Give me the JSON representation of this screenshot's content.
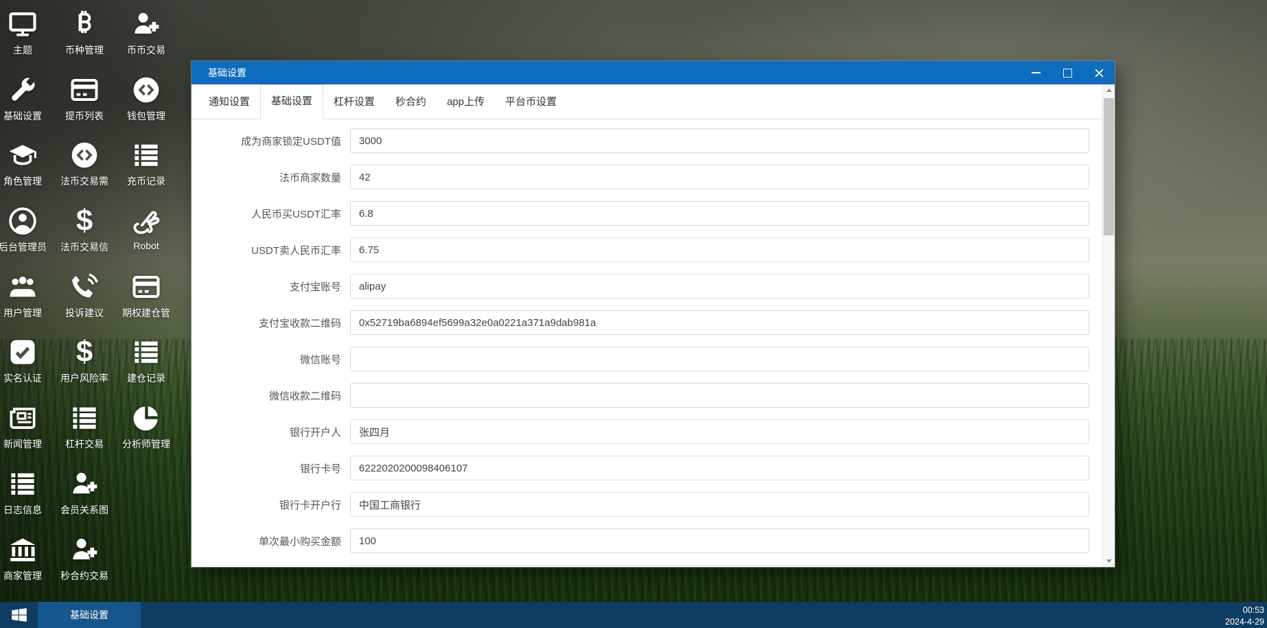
{
  "colors": {
    "titlebar_blue": "#0e6cbd",
    "taskbar_blue": "#0e3c63",
    "task_button_blue": "#17568a",
    "input_border": "#d9d9d9"
  },
  "sidebar": {
    "items": [
      {
        "label": "主题",
        "icon": "display-icon"
      },
      {
        "label": "币种管理",
        "icon": "bitcoin-icon"
      },
      {
        "label": "币币交易",
        "icon": "user-plus-icon"
      },
      {
        "label": "基础设置",
        "icon": "wrench-icon"
      },
      {
        "label": "提币列表",
        "icon": "credit-card-icon"
      },
      {
        "label": "钱包管理",
        "icon": "code-circle-icon"
      },
      {
        "label": "角色管理",
        "icon": "graduation-cap-icon"
      },
      {
        "label": "法币交易需",
        "icon": "code-circle-icon"
      },
      {
        "label": "充币记录",
        "icon": "list-icon"
      },
      {
        "label": "后台管理员",
        "icon": "user-circle-icon"
      },
      {
        "label": "法币交易信",
        "icon": "dollar-icon"
      },
      {
        "label": "Robot",
        "icon": "hand-icon"
      },
      {
        "label": "用户管理",
        "icon": "users-icon"
      },
      {
        "label": "投诉建议",
        "icon": "phone-volume-icon"
      },
      {
        "label": "期权建仓管",
        "icon": "credit-card-icon"
      },
      {
        "label": "实名认证",
        "icon": "check-square-icon"
      },
      {
        "label": "用户风险率",
        "icon": "dollar-icon"
      },
      {
        "label": "建仓记录",
        "icon": "list-icon"
      },
      {
        "label": "新闻管理",
        "icon": "newspaper-icon"
      },
      {
        "label": "杠杆交易",
        "icon": "list-icon"
      },
      {
        "label": "分析师管理",
        "icon": "pie-chart-icon"
      },
      {
        "label": "日志信息",
        "icon": "list-icon"
      },
      {
        "label": "会员关系图",
        "icon": "user-plus-icon"
      },
      {
        "label": "商家管理",
        "icon": "bank-icon"
      },
      {
        "label": "秒合约交易",
        "icon": "user-plus-icon"
      }
    ]
  },
  "dialog": {
    "title": "基础设置",
    "window_controls": [
      "minimize",
      "maximize",
      "close"
    ],
    "active_tab": 1,
    "tabs": [
      {
        "label": "通知设置"
      },
      {
        "label": "基础设置"
      },
      {
        "label": "杠杆设置"
      },
      {
        "label": "秒合约"
      },
      {
        "label": "app上传"
      },
      {
        "label": "平台币设置"
      }
    ],
    "fields": [
      {
        "label": "成为商家锁定USDT值",
        "value": "3000"
      },
      {
        "label": "法币商家数量",
        "value": "42"
      },
      {
        "label": "人民币买USDT汇率",
        "value": "6.8"
      },
      {
        "label": "USDT卖人民币汇率",
        "value": "6.75"
      },
      {
        "label": "支付宝账号",
        "value": "alipay"
      },
      {
        "label": "支付宝收款二维码",
        "value": "0x52719ba6894ef5699a32e0a0221a371a9dab981a"
      },
      {
        "label": "微信账号",
        "value": ""
      },
      {
        "label": "微信收款二维码",
        "value": ""
      },
      {
        "label": "银行开户人",
        "value": "张四月"
      },
      {
        "label": "银行卡号",
        "value": "6222020200098406107"
      },
      {
        "label": "银行卡开户行",
        "value": "中国工商银行"
      },
      {
        "label": "单次最小购买金额",
        "value": "100"
      }
    ]
  },
  "taskbar": {
    "task_label": "基础设置",
    "time": "00:53",
    "date": "2024-4-29"
  }
}
